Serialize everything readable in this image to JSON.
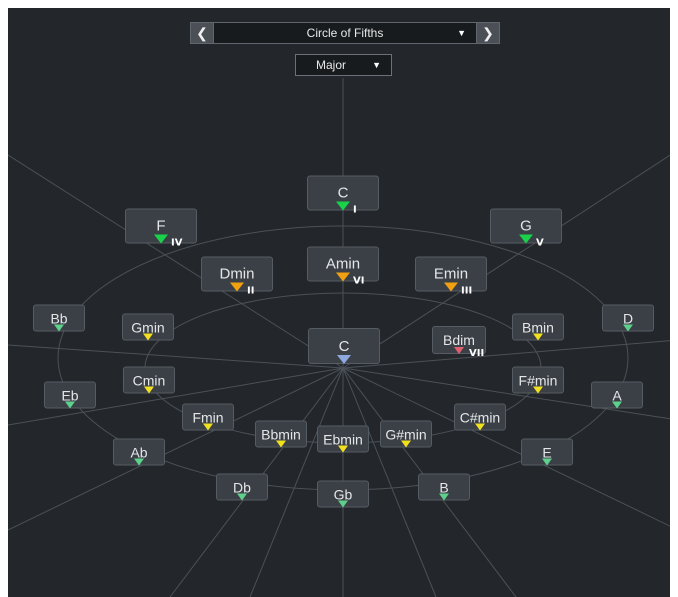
{
  "header": {
    "scheme_label": "Circle of Fifths",
    "prev_glyph": "❮",
    "next_glyph": "❯",
    "mode_label": "Major",
    "caret_glyph": "▼"
  },
  "center_chord": {
    "label": "C",
    "marker_color": "#8fa8e0"
  },
  "diatonic": [
    {
      "name": "chord-c-tonic",
      "label": "C",
      "degree": "I",
      "color": "#19d24a"
    },
    {
      "name": "chord-f-subdominant",
      "label": "F",
      "degree": "IV",
      "color": "#19d24a"
    },
    {
      "name": "chord-g-dominant",
      "label": "G",
      "degree": "V",
      "color": "#19d24a"
    },
    {
      "name": "chord-amin",
      "label": "Amin",
      "degree": "VI",
      "color": "#f0a010"
    },
    {
      "name": "chord-dmin",
      "label": "Dmin",
      "degree": "II",
      "color": "#f0a010"
    },
    {
      "name": "chord-emin",
      "label": "Emin",
      "degree": "III",
      "color": "#f0a010"
    },
    {
      "name": "chord-bdim",
      "label": "Bdim",
      "degree": "VII",
      "color": "#e06070"
    }
  ],
  "outer_ring": [
    {
      "name": "chord-bb",
      "label": "Bb",
      "color": "#5ed08c"
    },
    {
      "name": "chord-eb",
      "label": "Eb",
      "color": "#5ed08c"
    },
    {
      "name": "chord-ab",
      "label": "Ab",
      "color": "#5ed08c"
    },
    {
      "name": "chord-db",
      "label": "Db",
      "color": "#5ed08c"
    },
    {
      "name": "chord-gb",
      "label": "Gb",
      "color": "#5ed08c"
    },
    {
      "name": "chord-b",
      "label": "B",
      "color": "#5ed08c"
    },
    {
      "name": "chord-e",
      "label": "E",
      "color": "#5ed08c"
    },
    {
      "name": "chord-a",
      "label": "A",
      "color": "#5ed08c"
    },
    {
      "name": "chord-d",
      "label": "D",
      "color": "#5ed08c"
    }
  ],
  "inner_ring": [
    {
      "name": "chord-gmin",
      "label": "Gmin",
      "color": "#f0e020"
    },
    {
      "name": "chord-cmin",
      "label": "Cmin",
      "color": "#f0e020"
    },
    {
      "name": "chord-fmin",
      "label": "Fmin",
      "color": "#f0e020"
    },
    {
      "name": "chord-bbmin",
      "label": "Bbmin",
      "color": "#f0e020"
    },
    {
      "name": "chord-ebmin",
      "label": "Ebmin",
      "color": "#f0e020"
    },
    {
      "name": "chord-gsharpmin",
      "label": "G#min",
      "color": "#f0e020"
    },
    {
      "name": "chord-csharpmin",
      "label": "C#min",
      "color": "#f0e020"
    },
    {
      "name": "chord-fsharpmin",
      "label": "F#min",
      "color": "#f0e020"
    },
    {
      "name": "chord-bmin",
      "label": "Bmin",
      "color": "#f0e020"
    }
  ]
}
